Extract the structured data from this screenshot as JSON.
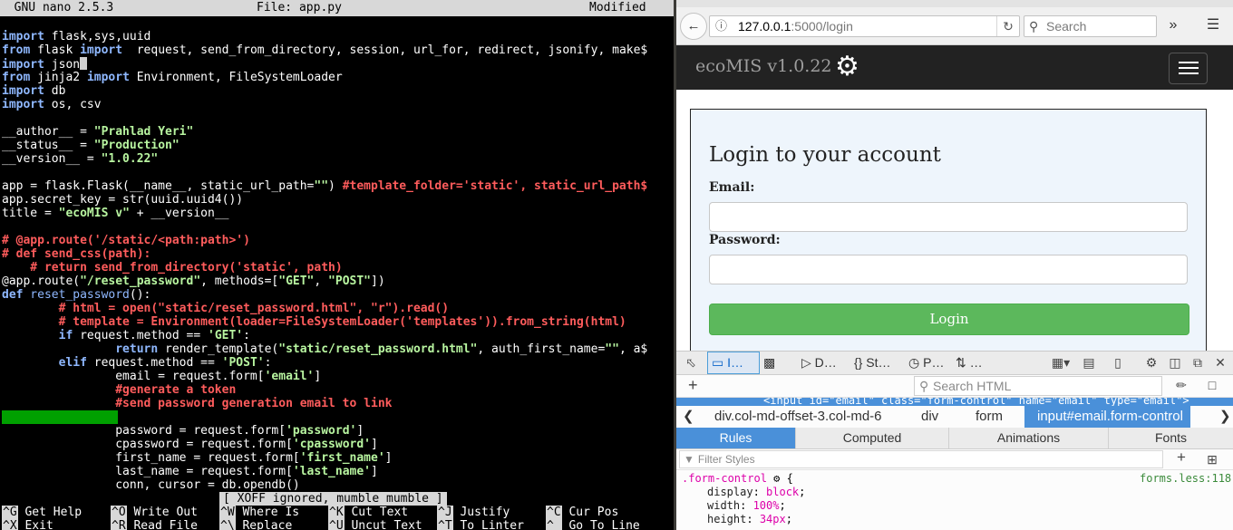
{
  "terminal": {
    "title_left": "  GNU nano 2.5.3",
    "title_center": "File: app.py",
    "title_right": "Modified",
    "status_message": "[ XOFF ignored, mumble mumble ]",
    "shortcuts": [
      {
        "key": "^G",
        "label": "Get Help"
      },
      {
        "key": "^O",
        "label": "Write Out"
      },
      {
        "key": "^W",
        "label": "Where Is"
      },
      {
        "key": "^K",
        "label": "Cut Text"
      },
      {
        "key": "^J",
        "label": "Justify"
      },
      {
        "key": "^C",
        "label": "Cur Pos"
      },
      {
        "key": "^X",
        "label": "Exit"
      },
      {
        "key": "^R",
        "label": "Read File"
      },
      {
        "key": "^\\",
        "label": "Replace"
      },
      {
        "key": "^U",
        "label": "Uncut Text"
      },
      {
        "key": "^T",
        "label": "To Linter"
      },
      {
        "key": "^_",
        "label": "Go To Line"
      }
    ],
    "code": {
      "l0_kw": "import",
      "l0_rest": " flask,sys,uuid",
      "l1_kw1": "from",
      "l1_mid": " flask ",
      "l1_kw2": "import",
      "l1_rest": "  request, send_from_directory, session, url_for, redirect, jsonify, make$",
      "l2_kw": "import",
      "l2_rest": " json",
      "l3_kw1": "from",
      "l3_mid": " jinja2 ",
      "l3_kw2": "import",
      "l3_rest": " Environment, FileSystemLoader",
      "l4_kw": "import",
      "l4_rest": " db",
      "l5_kw": "import",
      "l5_rest": " os, csv",
      "l7_a": "__author__ = ",
      "l7_s": "\"Prahlad Yeri\"",
      "l8_a": "__status__ = ",
      "l8_s": "\"Production\"",
      "l9_a": "__version__ = ",
      "l9_s": "\"1.0.22\"",
      "l11_a": "app = flask.Flask(__name__, static_url_path=",
      "l11_s": "\"\"",
      "l11_b": ") ",
      "l11_c": "#template_folder='static', static_url_path$",
      "l12": "app.secret_key = str(uuid.uuid4())",
      "l13_a": "title = ",
      "l13_s": "\"ecoMIS v\"",
      "l13_b": " + __version__",
      "l15": "# @app.route('/static/<path:path>')",
      "l16": "# def send_css(path):",
      "l17": "    # return send_from_directory('static', path)",
      "l18_a": "@app.route(",
      "l18_s1": "\"/reset_password\"",
      "l18_b": ", methods=[",
      "l18_s2": "\"GET\"",
      "l18_c": ", ",
      "l18_s3": "\"POST\"",
      "l18_d": "])",
      "l19_kw": "def",
      "l19_fn": " reset_password",
      "l19_rest": "():",
      "l20": "        # html = open(\"static/reset_password.html\", \"r\").read()",
      "l21": "        # template = Environment(loader=FileSystemLoader('templates')).from_string(html)",
      "l22_kw": "        if",
      "l22_a": " request.method == ",
      "l22_s": "'GET'",
      "l22_b": ":",
      "l23_kw": "                return",
      "l23_a": " render_template(",
      "l23_s1": "\"static/reset_password.html\"",
      "l23_b": ", auth_first_name=",
      "l23_s2": "\"\"",
      "l23_c": ", a$",
      "l24_kw": "        elif",
      "l24_a": " request.method == ",
      "l24_s": "'POST'",
      "l24_b": ":",
      "l25_a": "                email = request.form[",
      "l25_s": "'email'",
      "l25_b": "]",
      "l26": "                #generate a token",
      "l27": "                #send password generation email to link",
      "l29_a": "                password = request.form[",
      "l29_s": "'password'",
      "l29_b": "]",
      "l30_a": "                cpassword = request.form[",
      "l30_s": "'cpassword'",
      "l30_b": "]",
      "l31_a": "                first_name = request.form[",
      "l31_s": "'first_name'",
      "l31_b": "]",
      "l32_a": "                last_name = request.form[",
      "l32_s": "'last_name'",
      "l32_b": "]",
      "l33": "                conn, cursor = db.opendb()"
    }
  },
  "browser": {
    "back_icon": "back-arrow-icon",
    "url_host": "127.0.0.1",
    "url_rest": ":5000/login",
    "search_placeholder": "Search",
    "app": {
      "brand": "ecoMIS v1.0.22",
      "login_title": "Login to your account",
      "email_label": "Email:",
      "password_label": "Password:",
      "login_button": "Login",
      "button_color": "#5cb85c"
    },
    "devtools": {
      "tabs": [
        {
          "label": "I…",
          "icon": "inspector-icon"
        },
        {
          "label": "",
          "icon": "console-icon"
        },
        {
          "label": "D…",
          "icon": "debugger-icon"
        },
        {
          "label": "St…",
          "icon": "style-editor-icon"
        },
        {
          "label": "P…",
          "icon": "performance-icon"
        },
        {
          "label": "…",
          "icon": "network-icon"
        }
      ],
      "search_html_placeholder": "Search HTML",
      "markup_line": "<input id=\"email\" class=\"form-control\" name=\"email\" type=\"email\">",
      "breadcrumbs": [
        "div.col-md-offset-3.col-md-6",
        "div",
        "form",
        "input#email.form-control"
      ],
      "panel_tabs": [
        "Rules",
        "Computed",
        "Animations",
        "Fonts"
      ],
      "filter_placeholder": "Filter Styles",
      "rule_selector": ".form-control",
      "rule_source": "forms.less:118",
      "declarations": [
        {
          "prop": "display",
          "value": "block"
        },
        {
          "prop": "width",
          "value": "100%"
        },
        {
          "prop": "height",
          "value": "34px"
        }
      ]
    }
  }
}
